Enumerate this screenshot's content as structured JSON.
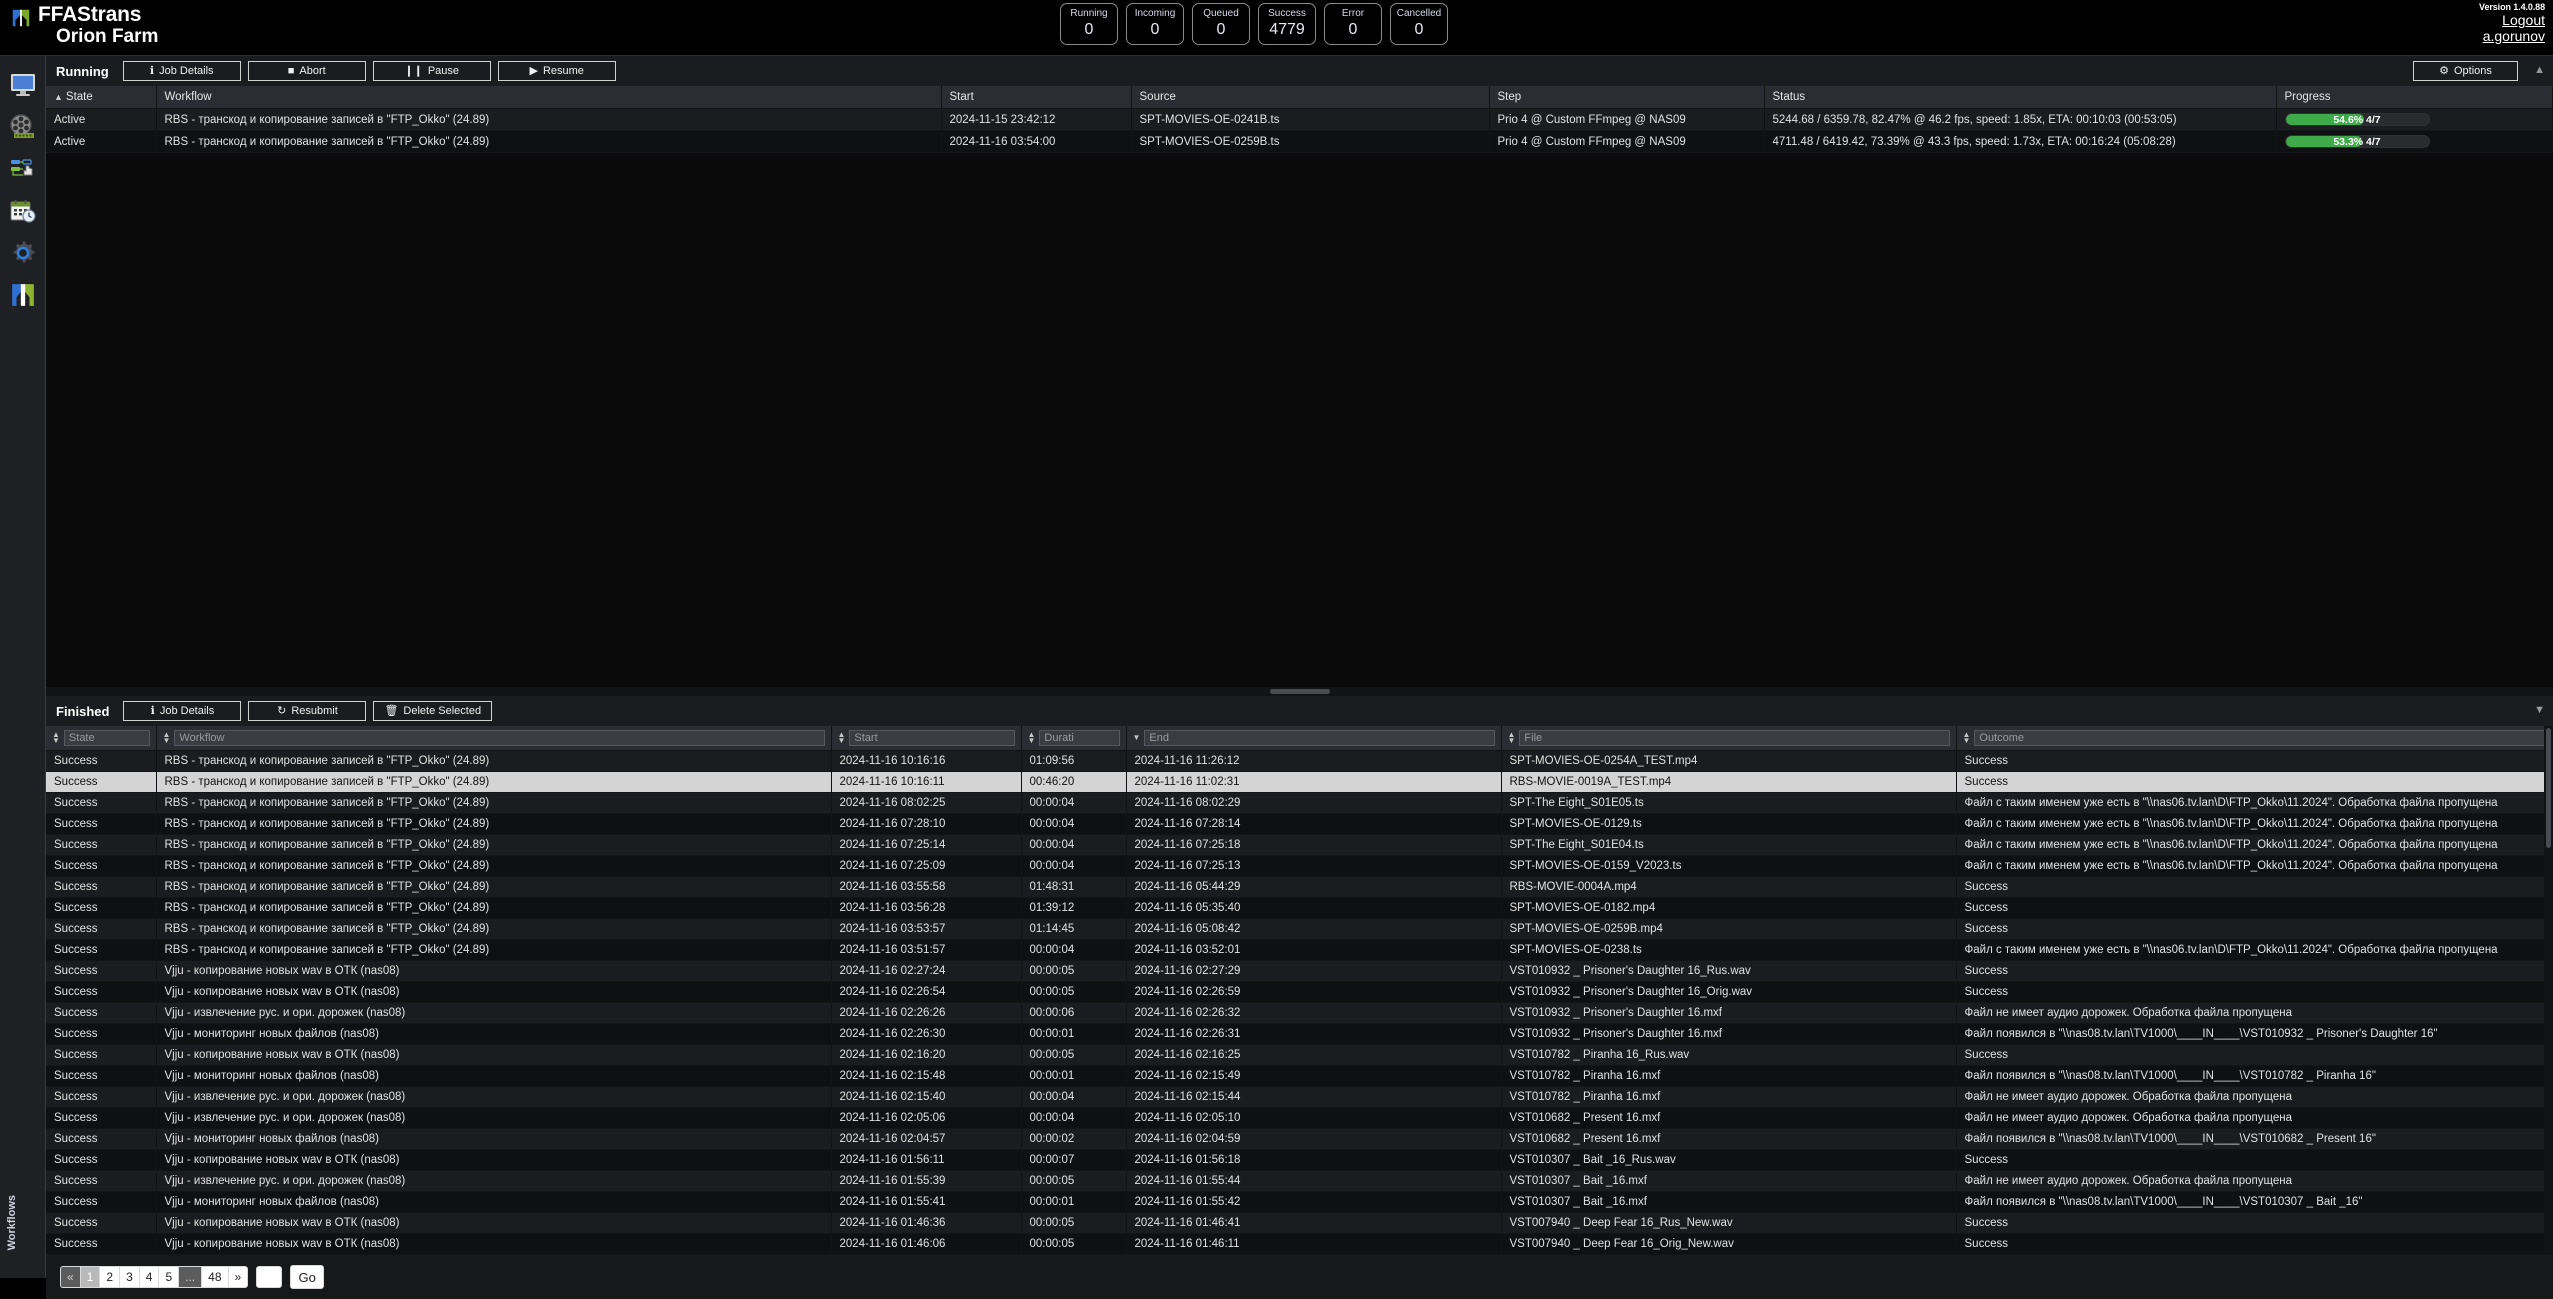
{
  "app": {
    "brand_name": "FFAStrans",
    "farm_name": "Orion Farm",
    "version": "Version 1.4.0.88",
    "logout_label": "Logout",
    "user": "a.gorunov"
  },
  "counters": [
    {
      "label": "Running",
      "value": "0"
    },
    {
      "label": "Incoming",
      "value": "0"
    },
    {
      "label": "Queued",
      "value": "0"
    },
    {
      "label": "Success",
      "value": "4779"
    },
    {
      "label": "Error",
      "value": "0"
    },
    {
      "label": "Cancelled",
      "value": "0"
    }
  ],
  "sidebar": {
    "items": [
      {
        "icon": "monitor-icon",
        "name": "sidebar-item-monitor"
      },
      {
        "icon": "film-reel-icon",
        "name": "sidebar-item-media"
      },
      {
        "icon": "workflow-hand-icon",
        "name": "sidebar-item-workflows"
      },
      {
        "icon": "calendar-clock-icon",
        "name": "sidebar-item-schedule"
      },
      {
        "icon": "gear-icon",
        "name": "sidebar-item-settings"
      },
      {
        "icon": "ffastrans-logo-icon",
        "name": "sidebar-item-about"
      }
    ],
    "tab_label": "Workflows"
  },
  "running": {
    "title": "Running",
    "buttons": [
      {
        "label": "Job Details",
        "glyph": "ℹ",
        "name": "running-job-details-button"
      },
      {
        "label": "Abort",
        "glyph": "■",
        "name": "running-abort-button"
      },
      {
        "label": "Pause",
        "glyph": "❙❙",
        "name": "running-pause-button"
      },
      {
        "label": "Resume",
        "glyph": "▶",
        "name": "running-resume-button"
      }
    ],
    "options_label": "Options",
    "columns": [
      "State",
      "Workflow",
      "Start",
      "Source",
      "Step",
      "Status",
      "Progress"
    ],
    "sorted_column": "State",
    "sort_direction": "▲",
    "rows": [
      {
        "state": "Active",
        "workflow": "RBS - транскод и копирование записей в \"FTP_Okko\" (24.89)",
        "start": "2024-11-15 23:42:12",
        "source": "SPT-MOVIES-OE-0241B.ts",
        "step": "Prio 4 @ Custom FFmpeg @ NAS09",
        "status": "5244.68 / 6359.78, 82.47% @ 46.2 fps, speed: 1.85x, ETA: 00:10:03 (00:53:05)",
        "progress_label": "54.6% 4/7",
        "progress_pct": 54.6
      },
      {
        "state": "Active",
        "workflow": "RBS - транскод и копирование записей в \"FTP_Okko\" (24.89)",
        "start": "2024-11-16 03:54:00",
        "source": "SPT-MOVIES-OE-0259B.ts",
        "step": "Prio 4 @ Custom FFmpeg @ NAS09",
        "status": "4711.48 / 6419.42, 73.39% @ 43.3 fps, speed: 1.73x, ETA: 00:16:24 (05:08:28)",
        "progress_label": "53.3% 4/7",
        "progress_pct": 53.3
      }
    ]
  },
  "finished": {
    "title": "Finished",
    "buttons": [
      {
        "label": "Job Details",
        "glyph": "ℹ",
        "name": "finished-job-details-button"
      },
      {
        "label": "Resubmit",
        "glyph": "↻",
        "name": "finished-resubmit-button"
      },
      {
        "label": "Delete Selected",
        "glyph": "🗑",
        "name": "finished-delete-selected-button"
      }
    ],
    "filters": [
      {
        "placeholder": "State",
        "value": "",
        "sort": "updown",
        "name": "filter-state"
      },
      {
        "placeholder": "Workflow",
        "value": "",
        "sort": "updown",
        "name": "filter-workflow"
      },
      {
        "placeholder": "Start",
        "value": "",
        "sort": "updown",
        "name": "filter-start"
      },
      {
        "placeholder": "Durati",
        "value": "",
        "sort": "updown",
        "name": "filter-duration"
      },
      {
        "placeholder": "End",
        "value": "",
        "sort": "down",
        "name": "filter-end"
      },
      {
        "placeholder": "File",
        "value": "",
        "sort": "updown",
        "name": "filter-file"
      },
      {
        "placeholder": "Outcome",
        "value": "",
        "sort": "updown",
        "name": "filter-outcome"
      }
    ],
    "rows": [
      {
        "state": "Success",
        "workflow": "RBS - транскод и копирование записей в \"FTP_Okko\" (24.89)",
        "start": "2024-11-16 10:16:16",
        "duration": "01:09:56",
        "end": "2024-11-16 11:26:12",
        "file": "SPT-MOVIES-OE-0254A_TEST.mp4",
        "outcome": "Success",
        "selected": false
      },
      {
        "state": "Success",
        "workflow": "RBS - транскод и копирование записей в \"FTP_Okko\" (24.89)",
        "start": "2024-11-16 10:16:11",
        "duration": "00:46:20",
        "end": "2024-11-16 11:02:31",
        "file": "RBS-MOVIE-0019A_TEST.mp4",
        "outcome": "Success",
        "selected": true
      },
      {
        "state": "Success",
        "workflow": "RBS - транскод и копирование записей в \"FTP_Okko\" (24.89)",
        "start": "2024-11-16 08:02:25",
        "duration": "00:00:04",
        "end": "2024-11-16 08:02:29",
        "file": "SPT-The Eight_S01E05.ts",
        "outcome": "Файл с таким именем уже есть в \"\\\\nas06.tv.lan\\D\\FTP_Okko\\11.2024\". Обработка файла пропущена",
        "selected": false
      },
      {
        "state": "Success",
        "workflow": "RBS - транскод и копирование записей в \"FTP_Okko\" (24.89)",
        "start": "2024-11-16 07:28:10",
        "duration": "00:00:04",
        "end": "2024-11-16 07:28:14",
        "file": "SPT-MOVIES-OE-0129.ts",
        "outcome": "Файл с таким именем уже есть в \"\\\\nas06.tv.lan\\D\\FTP_Okko\\11.2024\". Обработка файла пропущена",
        "selected": false
      },
      {
        "state": "Success",
        "workflow": "RBS - транскод и копирование записей в \"FTP_Okko\" (24.89)",
        "start": "2024-11-16 07:25:14",
        "duration": "00:00:04",
        "end": "2024-11-16 07:25:18",
        "file": "SPT-The Eight_S01E04.ts",
        "outcome": "Файл с таким именем уже есть в \"\\\\nas06.tv.lan\\D\\FTP_Okko\\11.2024\". Обработка файла пропущена",
        "selected": false
      },
      {
        "state": "Success",
        "workflow": "RBS - транскод и копирование записей в \"FTP_Okko\" (24.89)",
        "start": "2024-11-16 07:25:09",
        "duration": "00:00:04",
        "end": "2024-11-16 07:25:13",
        "file": "SPT-MOVIES-OE-0159_V2023.ts",
        "outcome": "Файл с таким именем уже есть в \"\\\\nas06.tv.lan\\D\\FTP_Okko\\11.2024\". Обработка файла пропущена",
        "selected": false
      },
      {
        "state": "Success",
        "workflow": "RBS - транскод и копирование записей в \"FTP_Okko\" (24.89)",
        "start": "2024-11-16 03:55:58",
        "duration": "01:48:31",
        "end": "2024-11-16 05:44:29",
        "file": "RBS-MOVIE-0004A.mp4",
        "outcome": "Success",
        "selected": false
      },
      {
        "state": "Success",
        "workflow": "RBS - транскод и копирование записей в \"FTP_Okko\" (24.89)",
        "start": "2024-11-16 03:56:28",
        "duration": "01:39:12",
        "end": "2024-11-16 05:35:40",
        "file": "SPT-MOVIES-OE-0182.mp4",
        "outcome": "Success",
        "selected": false
      },
      {
        "state": "Success",
        "workflow": "RBS - транскод и копирование записей в \"FTP_Okko\" (24.89)",
        "start": "2024-11-16 03:53:57",
        "duration": "01:14:45",
        "end": "2024-11-16 05:08:42",
        "file": "SPT-MOVIES-OE-0259B.mp4",
        "outcome": "Success",
        "selected": false
      },
      {
        "state": "Success",
        "workflow": "RBS - транскод и копирование записей в \"FTP_Okko\" (24.89)",
        "start": "2024-11-16 03:51:57",
        "duration": "00:00:04",
        "end": "2024-11-16 03:52:01",
        "file": "SPT-MOVIES-OE-0238.ts",
        "outcome": "Файл с таким именем уже есть в \"\\\\nas06.tv.lan\\D\\FTP_Okko\\11.2024\". Обработка файла пропущена",
        "selected": false
      },
      {
        "state": "Success",
        "workflow": "Vjju - копирование новых wav в ОТК (nas08)",
        "start": "2024-11-16 02:27:24",
        "duration": "00:00:05",
        "end": "2024-11-16 02:27:29",
        "file": "VST010932 _ Prisoner's Daughter 16_Rus.wav",
        "outcome": "Success",
        "selected": false
      },
      {
        "state": "Success",
        "workflow": "Vjju - копирование новых wav в ОТК (nas08)",
        "start": "2024-11-16 02:26:54",
        "duration": "00:00:05",
        "end": "2024-11-16 02:26:59",
        "file": "VST010932 _ Prisoner's Daughter 16_Orig.wav",
        "outcome": "Success",
        "selected": false
      },
      {
        "state": "Success",
        "workflow": "Vjju - извлечение рус. и ори. дорожек (nas08)",
        "start": "2024-11-16 02:26:26",
        "duration": "00:00:06",
        "end": "2024-11-16 02:26:32",
        "file": "VST010932 _ Prisoner's Daughter 16.mxf",
        "outcome": "Файл не имеет аудио дорожек. Обработка файла пропущена",
        "selected": false
      },
      {
        "state": "Success",
        "workflow": "Vjju - мониторинг новых файлов (nas08)",
        "start": "2024-11-16 02:26:30",
        "duration": "00:00:01",
        "end": "2024-11-16 02:26:31",
        "file": "VST010932 _ Prisoner's Daughter 16.mxf",
        "outcome": "Файл появился в \"\\\\nas08.tv.lan\\TV1000\\____IN____\\VST010932 _ Prisoner's Daughter 16\"",
        "selected": false
      },
      {
        "state": "Success",
        "workflow": "Vjju - копирование новых wav в ОТК (nas08)",
        "start": "2024-11-16 02:16:20",
        "duration": "00:00:05",
        "end": "2024-11-16 02:16:25",
        "file": "VST010782 _ Piranha 16_Rus.wav",
        "outcome": "Success",
        "selected": false
      },
      {
        "state": "Success",
        "workflow": "Vjju - мониторинг новых файлов (nas08)",
        "start": "2024-11-16 02:15:48",
        "duration": "00:00:01",
        "end": "2024-11-16 02:15:49",
        "file": "VST010782 _ Piranha 16.mxf",
        "outcome": "Файл появился в \"\\\\nas08.tv.lan\\TV1000\\____IN____\\VST010782 _ Piranha 16\"",
        "selected": false
      },
      {
        "state": "Success",
        "workflow": "Vjju - извлечение рус. и ори. дорожек (nas08)",
        "start": "2024-11-16 02:15:40",
        "duration": "00:00:04",
        "end": "2024-11-16 02:15:44",
        "file": "VST010782 _ Piranha 16.mxf",
        "outcome": "Файл не имеет аудио дорожек. Обработка файла пропущена",
        "selected": false
      },
      {
        "state": "Success",
        "workflow": "Vjju - извлечение рус. и ори. дорожек (nas08)",
        "start": "2024-11-16 02:05:06",
        "duration": "00:00:04",
        "end": "2024-11-16 02:05:10",
        "file": "VST010682 _ Present 16.mxf",
        "outcome": "Файл не имеет аудио дорожек. Обработка файла пропущена",
        "selected": false
      },
      {
        "state": "Success",
        "workflow": "Vjju - мониторинг новых файлов (nas08)",
        "start": "2024-11-16 02:04:57",
        "duration": "00:00:02",
        "end": "2024-11-16 02:04:59",
        "file": "VST010682 _ Present 16.mxf",
        "outcome": "Файл появился в \"\\\\nas08.tv.lan\\TV1000\\____IN____\\VST010682 _ Present 16\"",
        "selected": false
      },
      {
        "state": "Success",
        "workflow": "Vjju - копирование новых wav в ОТК (nas08)",
        "start": "2024-11-16 01:56:11",
        "duration": "00:00:07",
        "end": "2024-11-16 01:56:18",
        "file": "VST010307 _ Bait _16_Rus.wav",
        "outcome": "Success",
        "selected": false
      },
      {
        "state": "Success",
        "workflow": "Vjju - извлечение рус. и ори. дорожек (nas08)",
        "start": "2024-11-16 01:55:39",
        "duration": "00:00:05",
        "end": "2024-11-16 01:55:44",
        "file": "VST010307 _ Bait _16.mxf",
        "outcome": "Файл не имеет аудио дорожек. Обработка файла пропущена",
        "selected": false
      },
      {
        "state": "Success",
        "workflow": "Vjju - мониторинг новых файлов (nas08)",
        "start": "2024-11-16 01:55:41",
        "duration": "00:00:01",
        "end": "2024-11-16 01:55:42",
        "file": "VST010307 _ Bait _16.mxf",
        "outcome": "Файл появился в \"\\\\nas08.tv.lan\\TV1000\\____IN____\\VST010307 _ Bait _16\"",
        "selected": false
      },
      {
        "state": "Success",
        "workflow": "Vjju - копирование новых wav в ОТК (nas08)",
        "start": "2024-11-16 01:46:36",
        "duration": "00:00:05",
        "end": "2024-11-16 01:46:41",
        "file": "VST007940 _ Deep Fear 16_Rus_New.wav",
        "outcome": "Success",
        "selected": false
      },
      {
        "state": "Success",
        "workflow": "Vjju - копирование новых wav в ОТК (nas08)",
        "start": "2024-11-16 01:46:06",
        "duration": "00:00:05",
        "end": "2024-11-16 01:46:11",
        "file": "VST007940 _ Deep Fear 16_Orig_New.wav",
        "outcome": "Success",
        "selected": false
      }
    ]
  },
  "pagination": {
    "prev_label": "«",
    "next_label": "»",
    "ellipsis": "...",
    "pages": [
      "1",
      "2",
      "3",
      "4",
      "5"
    ],
    "active_page": "1",
    "last_page": "48",
    "goto_value": "",
    "go_label": "Go"
  },
  "colors": {
    "progress_fill": "#3faa49",
    "panel_bg": "#1b1c1f",
    "header_bg": "#2b2d33"
  }
}
